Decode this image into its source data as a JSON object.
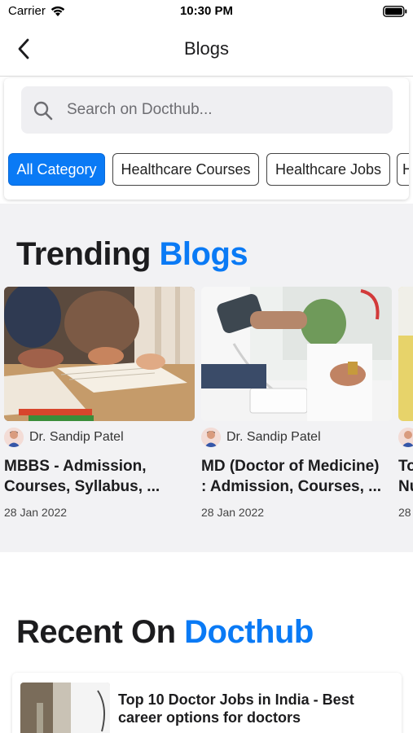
{
  "status_bar": {
    "carrier": "Carrier",
    "time": "10:30 PM",
    "icons": [
      "wifi-icon",
      "battery-icon"
    ]
  },
  "nav": {
    "title": "Blogs",
    "back_icon": "chevron-left-icon"
  },
  "search": {
    "placeholder": "Search on Docthub...",
    "value": "",
    "icon": "search-icon"
  },
  "categories": [
    {
      "label": "All Category",
      "active": true
    },
    {
      "label": "Healthcare Courses",
      "active": false
    },
    {
      "label": "Healthcare Jobs",
      "active": false
    },
    {
      "label": "H",
      "active": false
    }
  ],
  "trending": {
    "heading_main": "Trending",
    "heading_accent": "Blogs",
    "cards": [
      {
        "author": "Dr. Sandip Patel",
        "title": "MBBS -  Admission,\nCourses, Syllabus, ...",
        "date": "28 Jan 2022"
      },
      {
        "author": "Dr. Sandip Patel",
        "title": "MD (Doctor of Medicine)\n: Admission, Courses, ...",
        "date": "28 Jan 2022"
      },
      {
        "author": "",
        "title": "To\nNu",
        "date": "28"
      }
    ]
  },
  "recent": {
    "heading_main": "Recent On",
    "heading_accent": "Docthub",
    "items": [
      {
        "title": "Top 10 Doctor Jobs in India - Best\ncareer options for doctors"
      }
    ]
  },
  "colors": {
    "accent": "#0a7af5",
    "section_background": "#f2f2f4",
    "search_background": "#efeff2"
  }
}
